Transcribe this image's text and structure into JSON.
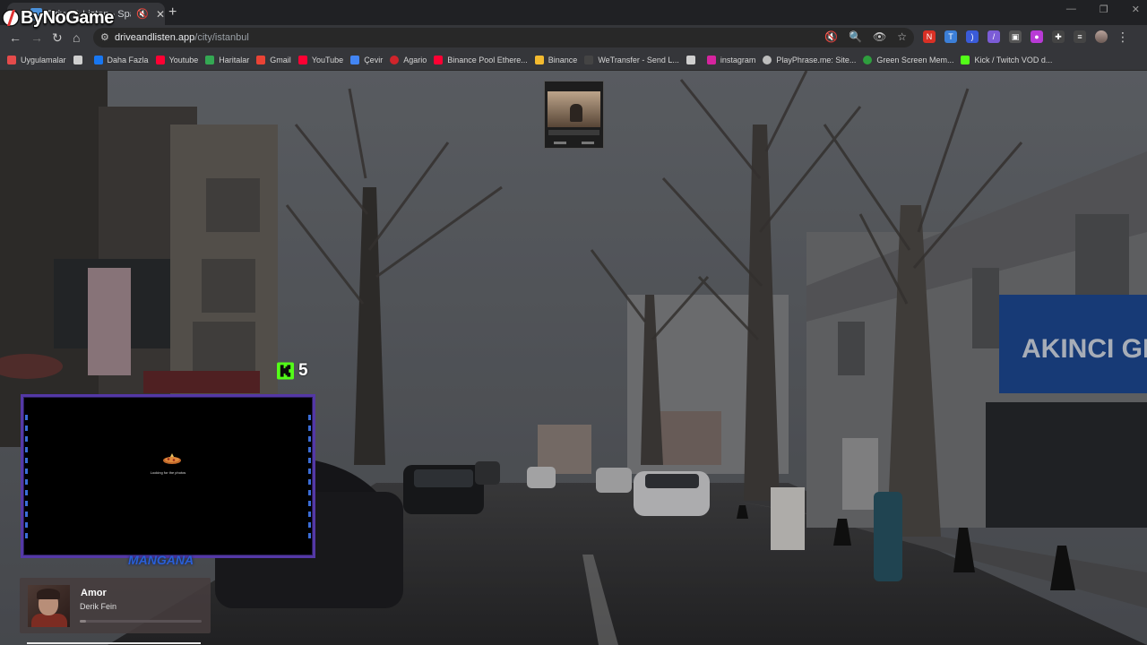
{
  "logo": {
    "text": "ByNoGame"
  },
  "tab": {
    "title": "Drive & Listen - Spain - Drive"
  },
  "toolbar": {
    "url_host": "driveandlisten.app",
    "url_path": "/city/istanbul"
  },
  "bookmarks": [
    {
      "label": "Uygulamalar",
      "icon": "apps-icon",
      "color": "#e54b4b"
    },
    {
      "label": "",
      "icon": "grid-icon",
      "color": "#cfcfcf"
    },
    {
      "label": "Daha Fazla",
      "icon": "facebook-icon",
      "color": "#1877f2"
    },
    {
      "label": "Youtube",
      "icon": "youtube-icon",
      "color": "#ff0033"
    },
    {
      "label": "Haritalar",
      "icon": "maps-icon",
      "color": "#34a853"
    },
    {
      "label": "Gmail",
      "icon": "gmail-icon",
      "color": "#ea4335"
    },
    {
      "label": "YouTube",
      "icon": "youtube-icon",
      "color": "#ff0033"
    },
    {
      "label": "Çevir",
      "icon": "translate-icon",
      "color": "#4285f4"
    },
    {
      "label": "Agario",
      "icon": "agario-icon",
      "color": "#d0242b"
    },
    {
      "label": "Binance Pool Ethere...",
      "icon": "youtube-icon",
      "color": "#ff0033"
    },
    {
      "label": "Binance",
      "icon": "binance-icon",
      "color": "#f3ba2f"
    },
    {
      "label": "WeTransfer - Send L...",
      "icon": "wetransfer-icon",
      "color": "#444444"
    },
    {
      "label": "",
      "icon": "bookmark-icon",
      "color": "#cfcfcf"
    },
    {
      "label": "instagram",
      "icon": "instagram-icon",
      "color": "#d6249f"
    },
    {
      "label": "PlayPhrase.me: Site...",
      "icon": "playphrase-icon",
      "color": "#bdbdbd"
    },
    {
      "label": "Green Screen Mem...",
      "icon": "greenscreen-icon",
      "color": "#2e9e3e"
    },
    {
      "label": "Kick / Twitch VOD d...",
      "icon": "kick-d-icon",
      "color": "#53fc18"
    }
  ],
  "kick": {
    "count": "5"
  },
  "stream": {
    "status": "Looking for the photos",
    "watermark": "MANGANA"
  },
  "music": {
    "title": "Amor",
    "artist": "Derik Fein",
    "progress": 0.05
  },
  "colors": {
    "kick_green": "#53fc18",
    "frame_purple": "#5438a6",
    "shop_sign": "#1f4e9e"
  }
}
